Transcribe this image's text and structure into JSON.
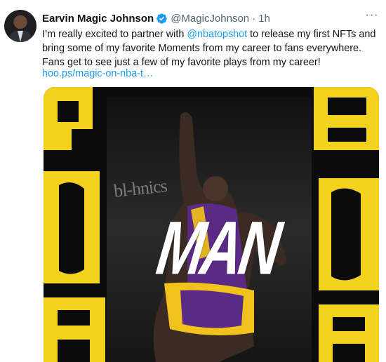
{
  "tweet": {
    "author_name": "Earvin Magic Johnson",
    "handle": "@MagicJohnson",
    "separator": "·",
    "time": "1h",
    "more_label": "···",
    "text_part1": "I’m really excited to partner with ",
    "mention": "@nbatopshot",
    "text_part2": " to release my first NFTs and bring some of my favorite Moments from my career to fans everywhere. Fans get to see just a few of my favorite plays from my career!",
    "link": "hoo.ps/magic-on-nba-t…"
  },
  "media": {
    "overlay_text": "MAN",
    "background_brand": "bl-hnics",
    "colors": {
      "accent_yellow": "#f2d21c",
      "background": "#0b0b0b",
      "jersey_purple": "#5b2a86",
      "jersey_gold": "#f2c21c"
    }
  },
  "icons": {
    "verified": "verified-badge-icon",
    "more": "more-options-icon"
  },
  "colors": {
    "link": "#1d9bf0",
    "secondary_text": "#536471",
    "primary_text": "#0f1419"
  }
}
